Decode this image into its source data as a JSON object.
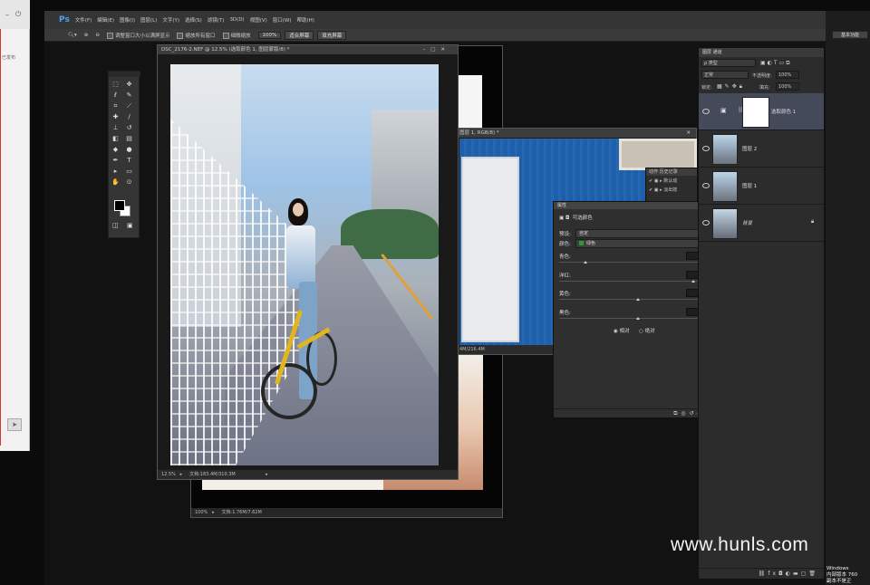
{
  "left_app": {
    "text": "已发布",
    "icon": "paper-plane-icon"
  },
  "photoshop": {
    "logo": "Ps",
    "menu": [
      "文件(F)",
      "编辑(E)",
      "图像(I)",
      "图层(L)",
      "文字(Y)",
      "选择(S)",
      "滤镜(T)",
      "3D(D)",
      "视图(V)",
      "窗口(W)",
      "帮助(H)"
    ],
    "options": {
      "resize_windows": "调整窗口大小以满屏显示",
      "zoom_all": "缩放所有窗口",
      "scrubby_zoom": "细微缩放",
      "btn_100": "100%",
      "btn_fit": "适合屏幕",
      "btn_fill": "填充屏幕"
    },
    "essentials": "基本功能"
  },
  "documents": {
    "main": {
      "title": "DSC_2176-2.NEF @ 12.5% (选取颜色 1, 图层蒙版/8) *",
      "zoom": "12.5%",
      "status": "文档:183.4M/310.3M"
    },
    "blue": {
      "title": "图层 1, RGB/8) *",
      "status": "4M/216.4M"
    },
    "back": {
      "zoom": "100%",
      "status": "文档:1.76M/7.62M"
    }
  },
  "properties": {
    "tab": "属性",
    "adjustment": "可选颜色",
    "preset_label": "预设:",
    "preset_value": "自定",
    "colors_label": "颜色:",
    "colors_value": "绿色",
    "sliders": [
      {
        "label": "青色:",
        "value": "-69",
        "unit": "%",
        "knob": 0.16
      },
      {
        "label": "洋红:",
        "value": "+62",
        "unit": "%",
        "knob": 0.86
      },
      {
        "label": "黄色:",
        "value": "0",
        "unit": "%",
        "knob": 0.5
      },
      {
        "label": "黑色:",
        "value": "0",
        "unit": "%",
        "knob": 0.5
      }
    ],
    "method_relative": "相对",
    "method_absolute": "绝对"
  },
  "history": {
    "tabs": "动作 历史记录",
    "items": [
      "默认动",
      "淡出效"
    ]
  },
  "layers": {
    "tabs": "图层  通道",
    "kind": "ρ 类型",
    "blend": "正常",
    "opacity_label": "不透明度:",
    "opacity": "100%",
    "lock_label": "锁定:",
    "fill_label": "填充:",
    "fill": "100%",
    "items": [
      {
        "name": "选取颜色 1"
      },
      {
        "name": "图层 2"
      },
      {
        "name": "图层 1"
      },
      {
        "name": "背景"
      }
    ]
  },
  "watermark": "www.hunls.com",
  "windows_info": {
    "line1": "Windows",
    "line2": "内部版本 760",
    "line3": "副本不是正"
  }
}
